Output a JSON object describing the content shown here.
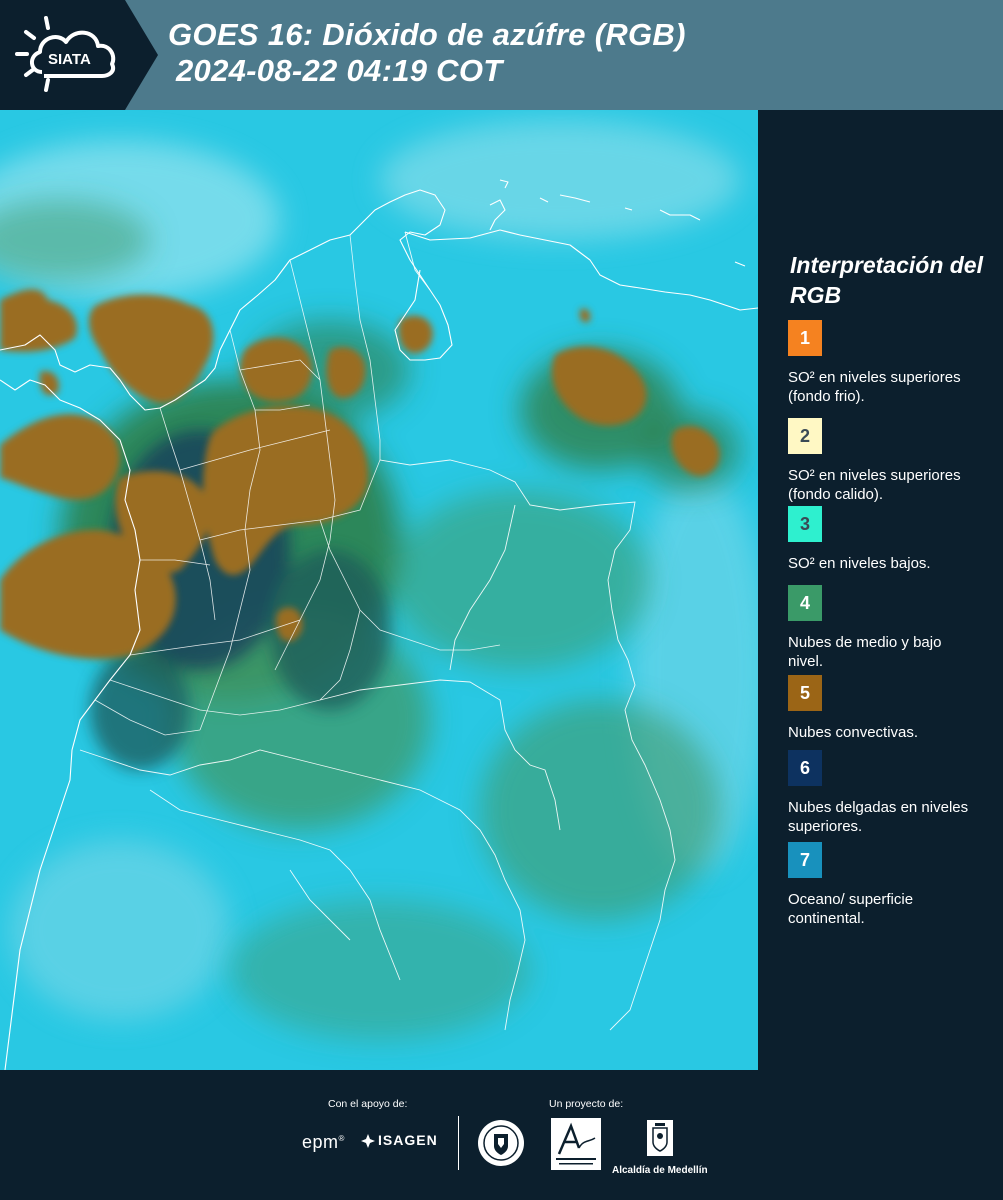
{
  "header": {
    "title_line1": "GOES 16: Dióxido de azúfre (RGB)",
    "title_line2": "2024-08-22 04:19 COT",
    "logo_text": "SIATA",
    "colors": {
      "bar": "#4d7a8c",
      "logo_block": "#0c1f2d"
    }
  },
  "map": {
    "colors": {
      "background": "#29c8e3",
      "sea_haze": "#8fe2ee",
      "low_cloud": "#3f9a6a",
      "mid_cloud": "#2e7f4b",
      "convective": "#9a6d24",
      "thin_high": "#143a5c",
      "border": "#ffffff"
    }
  },
  "legend": {
    "title": "Interpretación del RGB",
    "items": [
      {
        "number": "1",
        "color": "#f58220",
        "text": "SO² en niveles superiores (fondo frio)."
      },
      {
        "number": "2",
        "color": "#fff8c4",
        "text": "SO² en niveles superiores (fondo calido)."
      },
      {
        "number": "3",
        "color": "#2ef0cf",
        "text": "SO² en niveles bajos."
      },
      {
        "number": "4",
        "color": "#3a9a68",
        "text": "Nubes de medio y bajo nivel."
      },
      {
        "number": "5",
        "color": "#9b6516",
        "text": "Nubes convectivas."
      },
      {
        "number": "6",
        "color": "#0d3260",
        "text": "Nubes delgadas en niveles superiores."
      },
      {
        "number": "7",
        "color": "#1891bd",
        "text": "Oceano/ superficie continental."
      }
    ]
  },
  "footer": {
    "support_label": "Con el apoyo de:",
    "project_label": "Un proyecto de:",
    "epm": "epm",
    "isagen": "ISAGEN",
    "alcaldia": "Alcaldía de Medellín"
  }
}
